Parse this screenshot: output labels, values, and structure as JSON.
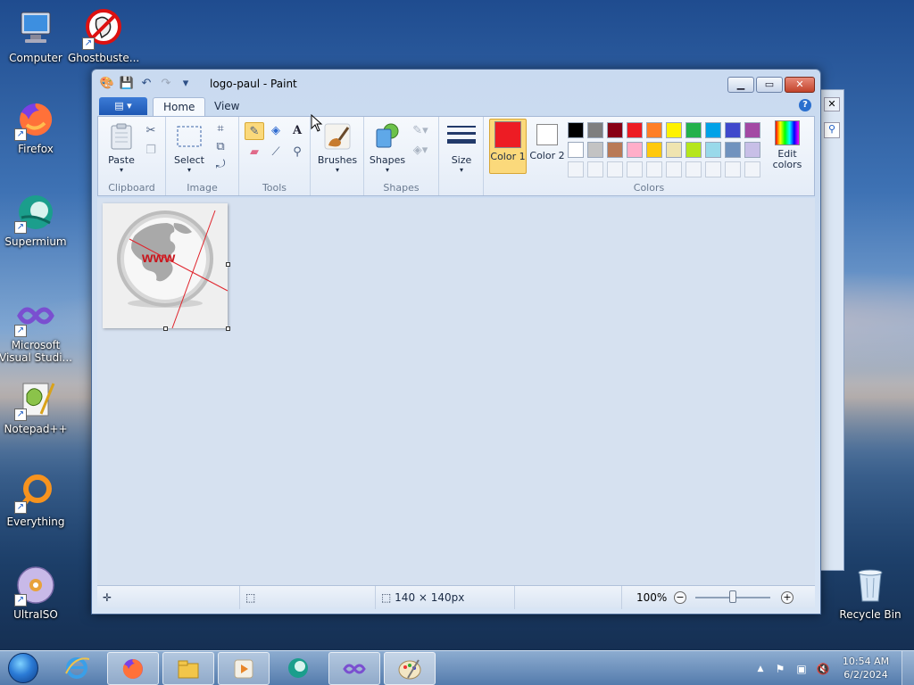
{
  "desktop": {
    "icons": [
      {
        "label": "Computer"
      },
      {
        "label": "Ghostbuste..."
      },
      {
        "label": "Firefox"
      },
      {
        "label": "Supermium"
      },
      {
        "label": "Microsoft Visual Studi..."
      },
      {
        "label": "Notepad++"
      },
      {
        "label": "Everything"
      },
      {
        "label": "UltraISO"
      },
      {
        "label": "Recycle Bin"
      }
    ]
  },
  "window": {
    "title": "logo-paul - Paint",
    "quick_access": [
      "save-icon",
      "undo-icon",
      "redo-icon",
      "customize-icon"
    ],
    "buttons": {
      "minimize": "▁",
      "maximize": "▭",
      "close": "✕"
    }
  },
  "ribbon": {
    "tabs": [
      {
        "label": "Home",
        "active": true
      },
      {
        "label": "View",
        "active": false
      }
    ],
    "groups": {
      "clipboard": {
        "label": "Clipboard",
        "paste": "Paste"
      },
      "image": {
        "label": "Image",
        "select": "Select"
      },
      "tools": {
        "label": "Tools"
      },
      "brushes": {
        "label": "Brushes"
      },
      "shapes": {
        "label": "Shapes",
        "shapes_btn": "Shapes"
      },
      "size": {
        "label": "Size"
      },
      "colors": {
        "label": "Colors",
        "color1": "Color 1",
        "color1_value": "#ed1c24",
        "color2": "Color 2",
        "color2_value": "#ffffff",
        "edit": "Edit colors",
        "palette_row1": [
          "#000000",
          "#7f7f7f",
          "#880015",
          "#ed1c24",
          "#ff7f27",
          "#fff200",
          "#22b14c",
          "#00a2e8",
          "#3f48cc",
          "#a349a4"
        ],
        "palette_row2": [
          "#ffffff",
          "#c3c3c3",
          "#b97a57",
          "#ffaec9",
          "#ffc90e",
          "#efe4b0",
          "#b5e61d",
          "#99d9ea",
          "#7092be",
          "#c8bfe7"
        ]
      }
    }
  },
  "canvas": {
    "logo_text": "www"
  },
  "statusbar": {
    "size": "140 × 140px",
    "zoom": "100%",
    "zoom_level": 1.0
  },
  "taskbar": {
    "items": [
      "internet-explorer-icon",
      "firefox-icon",
      "file-explorer-icon",
      "media-player-icon",
      "supermium-icon",
      "visual-studio-icon",
      "paint-icon"
    ],
    "clock_time": "10:54 AM",
    "clock_date": "6/2/2024"
  }
}
